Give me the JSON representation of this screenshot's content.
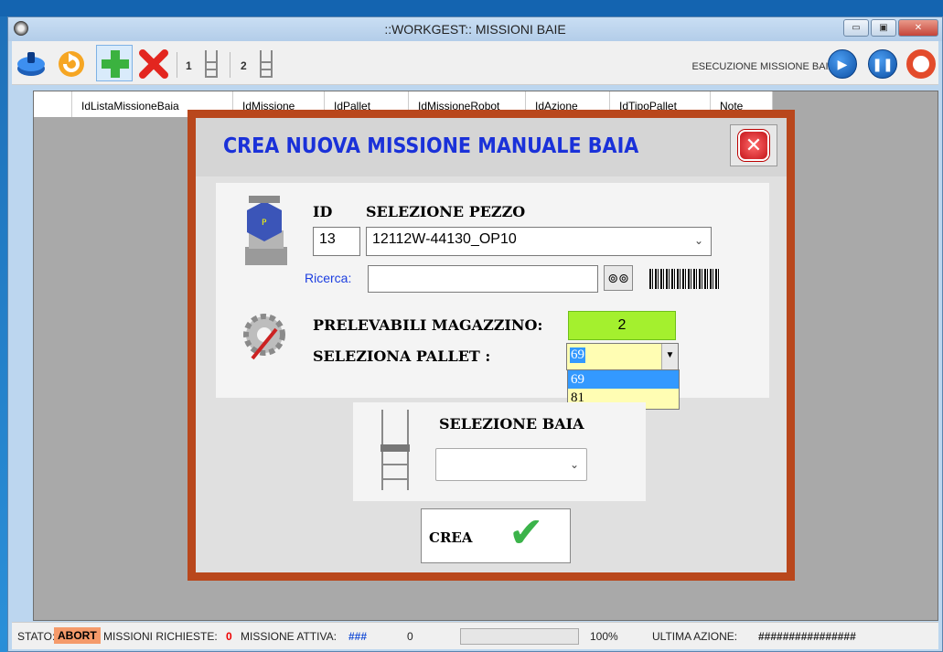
{
  "window": {
    "title": "::WORKGEST::  MISSIONI BAIE",
    "minimize": "▭",
    "maximize": "▣",
    "close": "✕"
  },
  "toolbar": {
    "bay1_num": "1",
    "bay2_num": "2",
    "exec_label": "ESECUZIONE MISSIONE BAIA:"
  },
  "grid": {
    "columns": [
      "IdListaMissioneBaia",
      "IdMissione",
      "IdPallet",
      "IdMissioneRobot",
      "IdAzione",
      "IdTipoPallet",
      "Note"
    ]
  },
  "dialog": {
    "title": "CREA NUOVA MISSIONE MANUALE BAIA",
    "id_label": "ID",
    "piece_label": "SELEZIONE PEZZO",
    "id_value": "13",
    "piece_value": "12112W-44130_OP10",
    "search_label": "Ricerca:",
    "search_value": "",
    "available_label": "PRELEVABILI MAGAZZINO:",
    "available_value": "2",
    "pallet_label": "SELEZIONA PALLET :",
    "pallet_selected": "69",
    "pallet_options": [
      "69",
      "81"
    ],
    "bay_label": "SELEZIONE BAIA",
    "bay_value": "",
    "create_label": "CREA"
  },
  "status": {
    "stato_label": "STATO:",
    "stato_value": "ABORT",
    "missions_label": "MISSIONI RICHIESTE:",
    "missions_value": "0",
    "active_label": "MISSIONE ATTIVA:",
    "active_value": "###",
    "progress_value": "0",
    "progress_percent": "100%",
    "last_action_label": "ULTIMA AZIONE:",
    "last_action_value": "################"
  }
}
